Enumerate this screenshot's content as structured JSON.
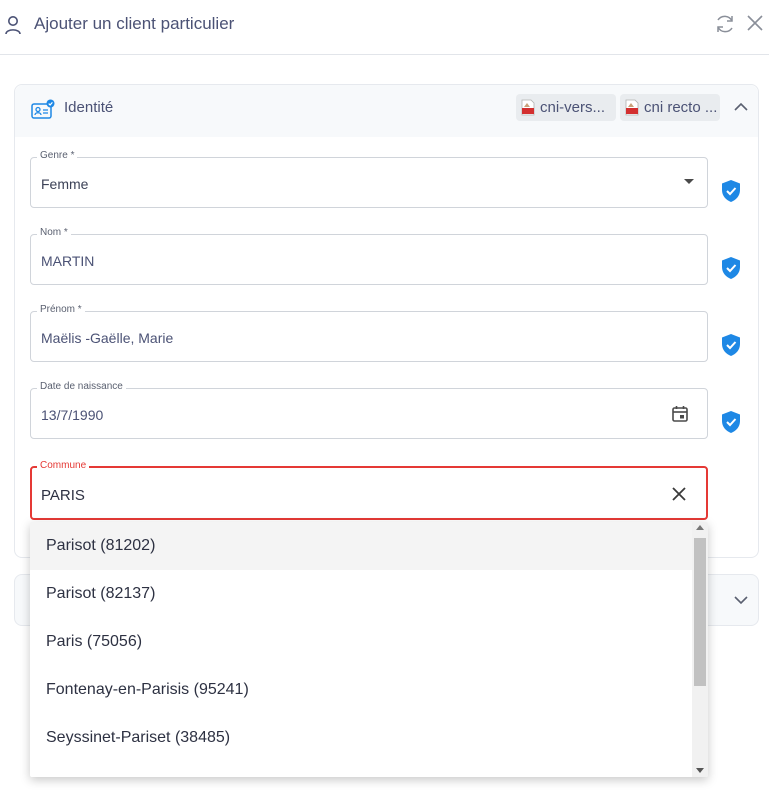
{
  "header": {
    "title": "Ajouter un client particulier"
  },
  "identity": {
    "title": "Identité",
    "documents": [
      {
        "label": "cni-vers..."
      },
      {
        "label": "cni recto ..."
      }
    ]
  },
  "fields": {
    "genre": {
      "label": "Genre *",
      "value": "Femme"
    },
    "nom": {
      "label": "Nom *",
      "value": "MARTIN"
    },
    "prenom": {
      "label": "Prénom *",
      "value": "Maëlis -Gaëlle, Marie"
    },
    "naissance": {
      "label": "Date de naissance",
      "value": "13/7/1990"
    },
    "commune": {
      "label": "Commune",
      "value": "PARIS"
    }
  },
  "suggestions": [
    "Parisot (81202)",
    "Parisot (82137)",
    "Paris (75056)",
    "Fontenay-en-Parisis (95241)",
    "Seyssinet-Pariset (38485)"
  ],
  "colors": {
    "accent": "#1e88e5",
    "error": "#e53935",
    "title": "#4b5275"
  }
}
